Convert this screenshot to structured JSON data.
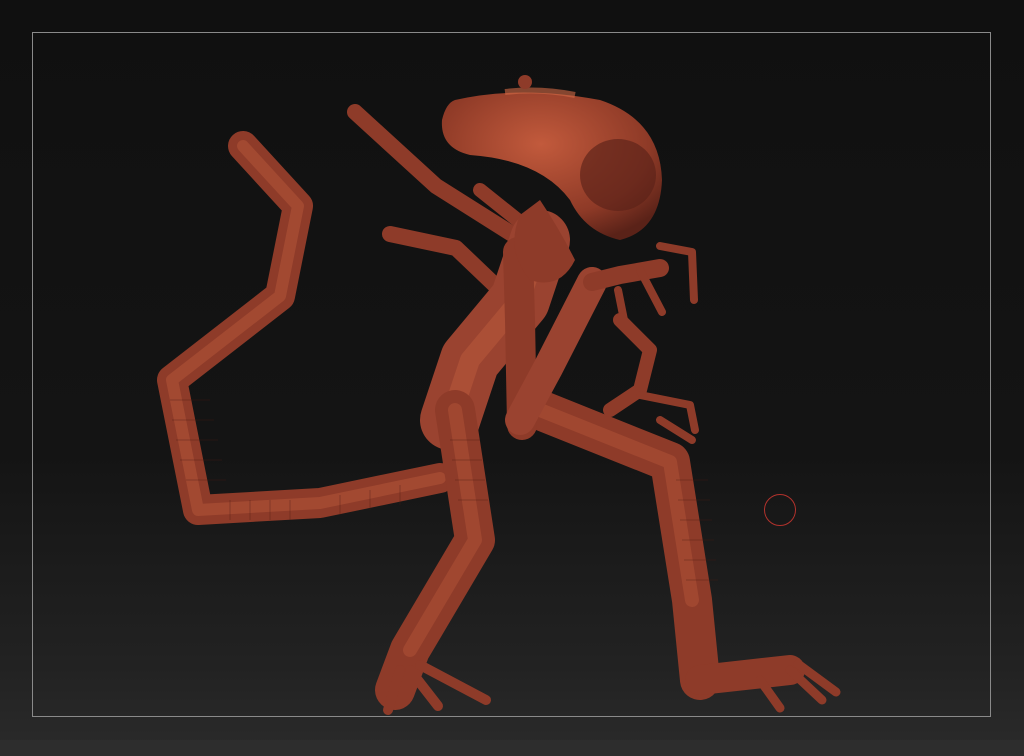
{
  "viewport": {
    "background_top": "#101010",
    "background_bottom": "#2b2b2b",
    "frame_color": "#8a8a8a"
  },
  "model": {
    "subject": "zsphere-alien-creature",
    "base_color": "#9e4430",
    "shadow_color": "#5a2218",
    "highlight_color": "#c8603f"
  },
  "brush": {
    "cursor_color": "#b2322c"
  }
}
